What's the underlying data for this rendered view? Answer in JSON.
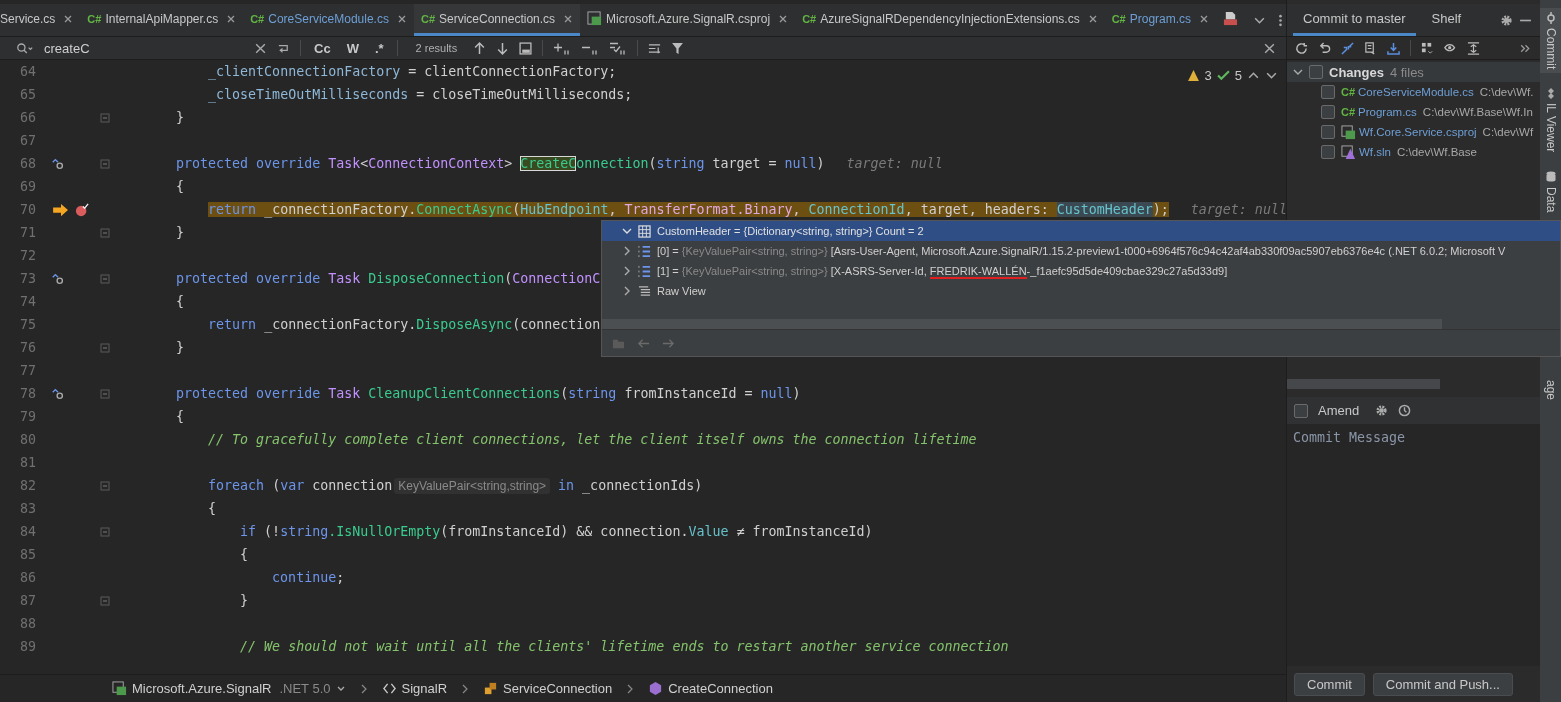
{
  "tabs": [
    {
      "label": "Service.cs",
      "kind": "none",
      "modified": false,
      "selected": false
    },
    {
      "label": "InternalApiMapper.cs",
      "kind": "cs",
      "icon_text": "C#",
      "modified": false,
      "selected": false
    },
    {
      "label": "CoreServiceModule.cs",
      "kind": "cs",
      "icon_text": "C#",
      "modified": true,
      "selected": false
    },
    {
      "label": "ServiceConnection.cs",
      "kind": "cs",
      "icon_text": "C#",
      "modified": false,
      "selected": true
    },
    {
      "label": "Microsoft.Azure.SignalR.csproj",
      "kind": "csproj",
      "modified": false,
      "selected": false
    },
    {
      "label": "AzureSignalRDependencyInjectionExtensions.cs",
      "kind": "cs",
      "icon_text": "C#",
      "modified": false,
      "selected": false
    },
    {
      "label": "Program.cs",
      "kind": "cs",
      "icon_text": "C#",
      "modified": true,
      "selected": false
    },
    {
      "kind": "yml",
      "selected": false
    }
  ],
  "search": {
    "value": "createC",
    "options": [
      {
        "label": "Cc",
        "on": false
      },
      {
        "label": "W",
        "on": false
      },
      {
        "label": ".*",
        "on": false
      }
    ],
    "results": "2 results"
  },
  "inspections": {
    "warnings": "3",
    "passed": "5"
  },
  "code": {
    "lines": [
      {
        "number": "64",
        "kind": "plain",
        "fold": false,
        "tokens": [
          {
            "text": "            _clientConnectionFactory",
            "kind": "field"
          },
          {
            "text": " = clientConnectionFactory;",
            "kind": "plain"
          }
        ]
      },
      {
        "number": "65",
        "kind": "plain",
        "fold": false,
        "tokens": [
          {
            "text": "            _closeTimeOutMilliseconds",
            "kind": "field"
          },
          {
            "text": " = closeTimeOutMilliseconds;",
            "kind": "plain"
          }
        ]
      },
      {
        "number": "66",
        "kind": "plain",
        "fold": true,
        "tokens": [
          {
            "text": "        }",
            "kind": "plain"
          }
        ]
      },
      {
        "number": "67",
        "kind": "plain",
        "fold": false
      },
      {
        "number": "68",
        "kind": "override",
        "fold": true,
        "tokens": [
          {
            "text": "        protected override ",
            "kind": "kw"
          },
          {
            "text": "Task",
            "kind": "type"
          },
          {
            "text": "<",
            "kind": "plain"
          },
          {
            "text": "ConnectionContext",
            "kind": "type"
          },
          {
            "text": "> ",
            "kind": "plain"
          },
          {
            "text": "CreateC",
            "kind": "match"
          },
          {
            "text": "onnection",
            "kind": "method"
          },
          {
            "text": "(",
            "kind": "plain"
          },
          {
            "text": "string",
            "kind": "kw"
          },
          {
            "text": " target = ",
            "kind": "plain"
          },
          {
            "text": "null",
            "kind": "kw"
          },
          {
            "text": ")",
            "kind": "plain"
          },
          {
            "text": "target: null",
            "kind": "hint"
          }
        ]
      },
      {
        "number": "69",
        "kind": "plain",
        "fold": false,
        "tokens": [
          {
            "text": "        {",
            "kind": "plain"
          }
        ]
      },
      {
        "number": "70",
        "kind": "execution",
        "fold": false,
        "current": true,
        "tokens": [
          {
            "text": "            return",
            "kind": "kw"
          },
          {
            "text": " _connectionFactory.",
            "kind": "plain"
          },
          {
            "text": "ConnectAsync",
            "kind": "method"
          },
          {
            "text": "(",
            "kind": "plain"
          },
          {
            "text": "HubEndpoint",
            "kind": "prop"
          },
          {
            "text": ", ",
            "kind": "plain"
          },
          {
            "text": "TransferFormat.Binary",
            "kind": "enum"
          },
          {
            "text": ", ",
            "kind": "plain"
          },
          {
            "text": "ConnectionId",
            "kind": "prop"
          },
          {
            "text": ", target, headers: ",
            "kind": "plain"
          },
          {
            "text": "CustomHeader",
            "kind": "hover"
          },
          {
            "text": ");",
            "kind": "plain"
          },
          {
            "text": "target: null",
            "kind": "hint"
          }
        ]
      },
      {
        "number": "71",
        "kind": "plain",
        "fold": true,
        "tokens": [
          {
            "text": "        }",
            "kind": "plain"
          }
        ]
      },
      {
        "number": "72",
        "kind": "plain",
        "fold": false
      },
      {
        "number": "73",
        "kind": "override",
        "fold": true,
        "tokens": [
          {
            "text": "        protected override ",
            "kind": "kw"
          },
          {
            "text": "Task",
            "kind": "type"
          },
          {
            "text": " DisposeConnection",
            "kind": "method"
          },
          {
            "text": "(",
            "kind": "plain"
          },
          {
            "text": "ConnectionC",
            "kind": "type"
          }
        ]
      },
      {
        "number": "74",
        "kind": "plain",
        "fold": false,
        "tokens": [
          {
            "text": "        {",
            "kind": "plain"
          }
        ]
      },
      {
        "number": "75",
        "kind": "plain",
        "fold": false,
        "tokens": [
          {
            "text": "            return",
            "kind": "kw"
          },
          {
            "text": " _connectionFactory.",
            "kind": "plain"
          },
          {
            "text": "DisposeAsync",
            "kind": "method"
          },
          {
            "text": "(connection",
            "kind": "plain"
          }
        ]
      },
      {
        "number": "76",
        "kind": "plain",
        "fold": true,
        "tokens": [
          {
            "text": "        }",
            "kind": "plain"
          }
        ]
      },
      {
        "number": "77",
        "kind": "plain",
        "fold": false
      },
      {
        "number": "78",
        "kind": "override",
        "fold": true,
        "tokens": [
          {
            "text": "        protected override ",
            "kind": "kw"
          },
          {
            "text": "Task",
            "kind": "type"
          },
          {
            "text": " CleanupClientConnections",
            "kind": "method"
          },
          {
            "text": "(",
            "kind": "plain"
          },
          {
            "text": "string",
            "kind": "kw"
          },
          {
            "text": " fromInstanceId = ",
            "kind": "plain"
          },
          {
            "text": "null",
            "kind": "kw"
          },
          {
            "text": ")",
            "kind": "plain"
          }
        ]
      },
      {
        "number": "79",
        "kind": "plain",
        "fold": false,
        "tokens": [
          {
            "text": "        {",
            "kind": "plain"
          }
        ]
      },
      {
        "number": "80",
        "kind": "plain",
        "fold": false,
        "tokens": [
          {
            "text": "            // To gracefully complete client connections, let the client itself owns the connection lifetime",
            "kind": "comment"
          }
        ]
      },
      {
        "number": "81",
        "kind": "plain",
        "fold": false
      },
      {
        "number": "82",
        "kind": "plain",
        "fold": true,
        "tokens": [
          {
            "text": "            foreach",
            "kind": "kw"
          },
          {
            "text": " (",
            "kind": "plain"
          },
          {
            "text": "var",
            "kind": "kw"
          },
          {
            "text": " connection",
            "kind": "plain"
          },
          {
            "text": "KeyValuePair<string,string>",
            "kind": "typehint"
          },
          {
            "text": "in",
            "kind": "kw"
          },
          {
            "text": " _connectionIds)",
            "kind": "plain"
          }
        ]
      },
      {
        "number": "83",
        "kind": "plain",
        "fold": false,
        "tokens": [
          {
            "text": "            {",
            "kind": "plain"
          }
        ]
      },
      {
        "number": "84",
        "kind": "plain",
        "fold": true,
        "tokens": [
          {
            "text": "                if",
            "kind": "kw"
          },
          {
            "text": " (!",
            "kind": "plain"
          },
          {
            "text": "string",
            "kind": "kw"
          },
          {
            "text": ".IsNullOrEmpty",
            "kind": "method"
          },
          {
            "text": "(fromInstanceId) && connection.",
            "kind": "plain"
          },
          {
            "text": "Value",
            "kind": "prop"
          },
          {
            "text": " ≠ fromInstanceId)",
            "kind": "plain"
          }
        ]
      },
      {
        "number": "85",
        "kind": "plain",
        "fold": false,
        "tokens": [
          {
            "text": "                {",
            "kind": "plain"
          }
        ]
      },
      {
        "number": "86",
        "kind": "plain",
        "fold": false,
        "tokens": [
          {
            "text": "                    continue",
            "kind": "kw"
          },
          {
            "text": ";",
            "kind": "plain"
          }
        ]
      },
      {
        "number": "87",
        "kind": "plain",
        "fold": true,
        "tokens": [
          {
            "text": "                }",
            "kind": "plain"
          }
        ]
      },
      {
        "number": "88",
        "kind": "plain",
        "fold": false
      },
      {
        "number": "89",
        "kind": "plain",
        "fold": false,
        "tokens": [
          {
            "text": "                // We should not wait until all the clients' lifetime ends to restart another service connection",
            "kind": "comment"
          }
        ]
      }
    ]
  },
  "debug_popup": {
    "header": {
      "text": "CustomHeader = {Dictionary<string, string>} Count = 2",
      "expanded": true,
      "selected": true
    },
    "rows": [
      {
        "index": "[0] = ",
        "type": "{KeyValuePair<string, string>}",
        "expanded": false,
        "value": [
          {
            "text": "[Asrs-User-Agent, Microsoft.Azure.SignalR/1.15.2-preview1-t000+6964f576c94c42af4ab330f09ac5907eb6376e4c (.NET 6.0.2; Microsoft V",
            "underlined": false
          }
        ]
      },
      {
        "index": "[1] = ",
        "type": "{KeyValuePair<string, string>}",
        "expanded": false,
        "value": [
          {
            "text": "[X-ASRS-Server-Id, ",
            "underlined": false
          },
          {
            "text": "FREDRIK-WALLÉN",
            "underlined": true
          },
          {
            "text": "-_f1aefc95d5de409cbae329c27a5d33d9]",
            "underlined": false
          }
        ]
      }
    ],
    "raw_view": {
      "label": "Raw View",
      "expanded": false
    }
  },
  "breadcrumb": [
    {
      "kind": "project",
      "text": "Microsoft.Azure.SignalR",
      "note": ".NET 5.0"
    },
    {
      "kind": "namespace",
      "text": "SignalR"
    },
    {
      "kind": "class",
      "text": "ServiceConnection"
    },
    {
      "kind": "method",
      "text": "CreateConnection"
    }
  ],
  "commit_panel": {
    "tabs": [
      {
        "label": "Commit to master",
        "selected": true
      },
      {
        "label": "Shelf",
        "selected": false
      }
    ],
    "changes": {
      "label": "Changes",
      "count": "4 files",
      "expanded": true,
      "checked": false,
      "files": [
        {
          "name": "CoreServiceModule.cs",
          "path": "C:\\dev\\Wf.",
          "kind": "cs",
          "icon_text": "C#",
          "checked": false
        },
        {
          "name": "Program.cs",
          "path": "C:\\dev\\Wf.Base\\Wf.In",
          "kind": "cs",
          "icon_text": "C#",
          "checked": false
        },
        {
          "name": "Wf.Core.Service.csproj",
          "path": "C:\\dev\\Wf",
          "kind": "csproj",
          "checked": false
        },
        {
          "name": "Wf.sln",
          "path": "C:\\dev\\Wf.Base",
          "kind": "sln",
          "checked": false
        }
      ]
    },
    "amend": {
      "label": "Amend",
      "checked": false
    },
    "message": {
      "placeholder": "Commit Message"
    },
    "buttons": [
      "Commit",
      "Commit and Push..."
    ]
  },
  "side_stripe": [
    {
      "label": "Commit",
      "kind": "commit",
      "selected": true
    },
    {
      "label": "IL Viewer",
      "kind": "il",
      "selected": false
    },
    {
      "label": "Data",
      "kind": "data",
      "selected": false
    },
    {
      "label": "age",
      "kind": "none",
      "selected": false
    }
  ]
}
